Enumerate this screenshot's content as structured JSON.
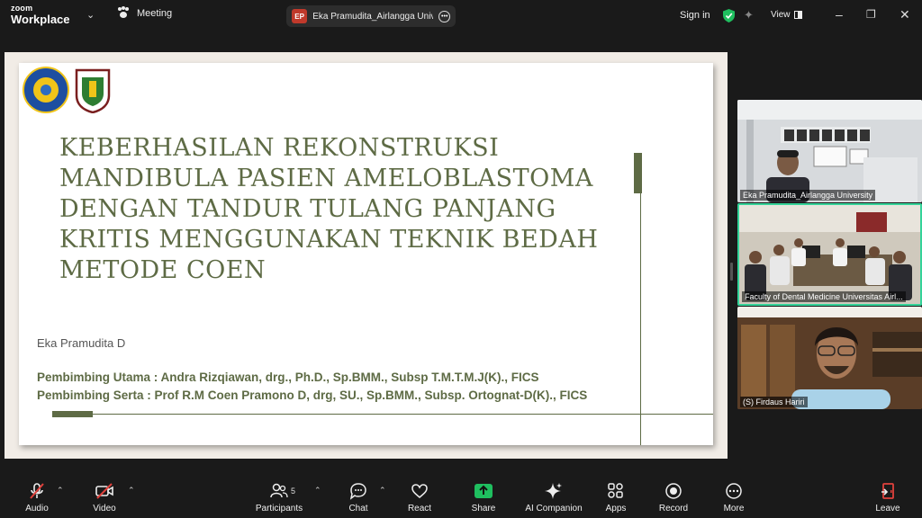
{
  "app": {
    "brand_line1": "zoom",
    "brand_line2": "Workplace"
  },
  "topbar": {
    "meeting_label": "Meeting",
    "meeting_title_initials": "EP",
    "meeting_title": "Eka Pramudita_Airlangga Univers",
    "signin_label": "Sign in",
    "view_label": "View"
  },
  "slide": {
    "title": "KEBERHASILAN REKONSTRUKSI MANDIBULA PASIEN AMELOBLASTOMA DENGAN TANDUR TULANG PANJANG KRITIS MENGGUNAKAN TEKNIK BEDAH METODE COEN",
    "author": "Eka Pramudita D",
    "advisor_main": "Pembimbing Utama : Andra Rizqiawan, drg., Ph.D., Sp.BMM., Subsp T.M.T.M.J(K)., FICS",
    "advisor_co": "Pembimbing Serta : Prof R.M Coen Pramono D, drg, SU., Sp.BMM., Subsp. Ortognat-D(K)., FICS"
  },
  "participants_tiles": [
    {
      "name": "Eka Pramudita_Airlangga University"
    },
    {
      "name": "Faculty of Dental Medicine Universitas Airl..."
    },
    {
      "name": "(S) Firdaus Hariri"
    }
  ],
  "toolbar": {
    "audio": "Audio",
    "video": "Video",
    "participants": "Participants",
    "participants_count": "5",
    "chat": "Chat",
    "react": "React",
    "share": "Share",
    "ai_companion": "AI Companion",
    "apps": "Apps",
    "record": "Record",
    "more": "More",
    "leave": "Leave"
  },
  "colors": {
    "share_green": "#1fbf5f",
    "slide_olive": "#5e6b45",
    "active_speaker_border": "#34d399",
    "leave_red": "#e0413c"
  }
}
